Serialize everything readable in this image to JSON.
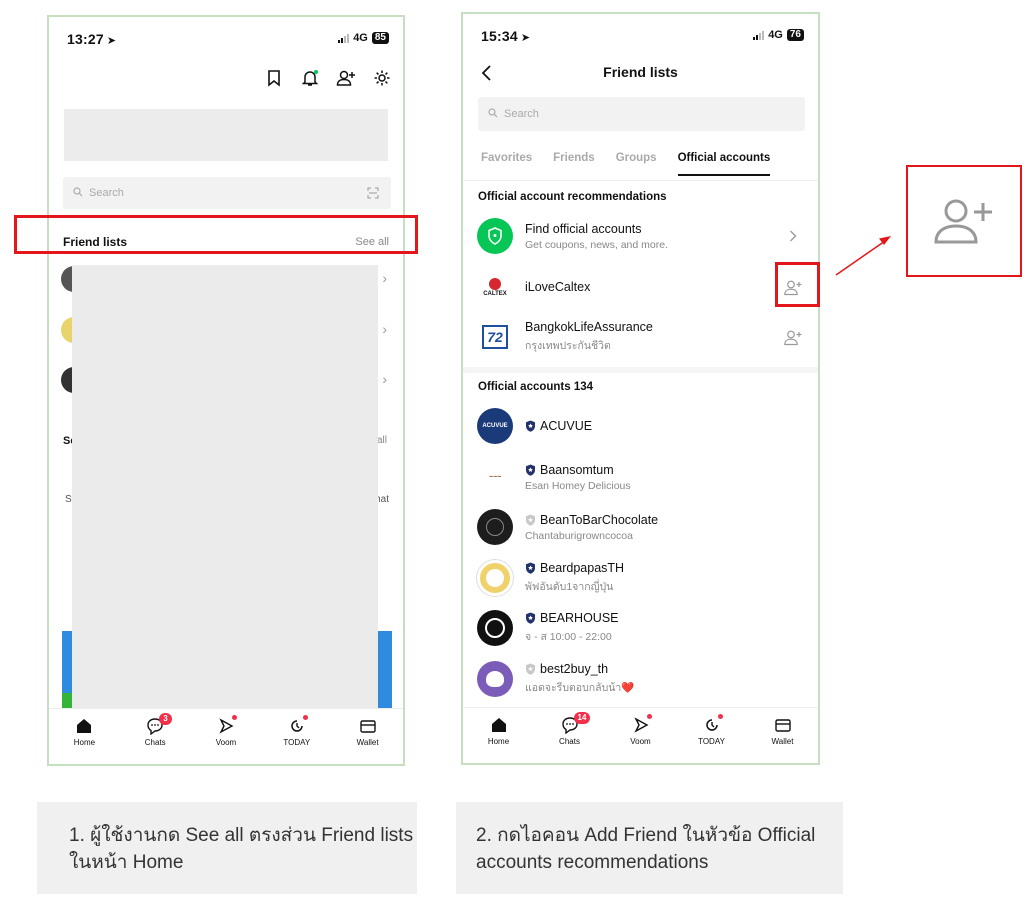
{
  "phone1": {
    "status": {
      "time": "13:27",
      "network": "4G",
      "battery": "85"
    },
    "search_placeholder": "Search",
    "friend_lists_title": "Friend lists",
    "see_all": "See all",
    "fragments": {
      "section_left": "Se",
      "section_right": "all",
      "left_label": "St",
      "right_label": "hat"
    },
    "tabbar": [
      {
        "label": "Home"
      },
      {
        "label": "Chats",
        "badge": "3"
      },
      {
        "label": "Voom"
      },
      {
        "label": "TODAY"
      },
      {
        "label": "Wallet"
      }
    ]
  },
  "phone2": {
    "status": {
      "time": "15:34",
      "network": "4G",
      "battery": "76"
    },
    "title": "Friend lists",
    "search_placeholder": "Search",
    "tabs": [
      "Favorites",
      "Friends",
      "Groups",
      "Official accounts"
    ],
    "recommend_heading": "Official account recommendations",
    "recommendations": [
      {
        "name": "Find official accounts",
        "sub": "Get coupons, news, and more."
      },
      {
        "name": "iLoveCaltex",
        "sub": "",
        "avatar_text": "CALTEX"
      },
      {
        "name": "BangkokLifeAssurance",
        "sub": "กรุงเทพประกันชีวิต",
        "avatar_text": "72"
      }
    ],
    "accounts_heading": "Official accounts 134",
    "accounts": [
      {
        "name": "ACUVUE",
        "sub": "",
        "avatar_text": "ACUVUE"
      },
      {
        "name": "Baansomtum",
        "sub": "Esan Homey Delicious"
      },
      {
        "name": "BeanToBarChocolate",
        "sub": "Chantaburigrowncocoa"
      },
      {
        "name": "BeardpapasTH",
        "sub": "พัฟอันดับ1จากญี่ปุ่น"
      },
      {
        "name": "BEARHOUSE",
        "sub": "จ - ส 10:00 - 22:00"
      },
      {
        "name": "best2buy_th",
        "sub": "แอดจะรีบตอบกลับน้า❤️"
      }
    ],
    "tabbar": [
      {
        "label": "Home"
      },
      {
        "label": "Chats",
        "badge": "14"
      },
      {
        "label": "Voom"
      },
      {
        "label": "TODAY"
      },
      {
        "label": "Wallet"
      }
    ]
  },
  "captions": {
    "step1": "1. ผู้ใช้งานกด See all ตรงส่วน Friend lists ในหน้า Home",
    "step2": "2. กดไอคอน Add Friend ในหัวข้อ Official accounts recommendations"
  },
  "colors": {
    "highlight": "#e3161c",
    "line_green": "#06c755",
    "badge": "#f2304a",
    "phone_border": "#c6dfc0"
  }
}
